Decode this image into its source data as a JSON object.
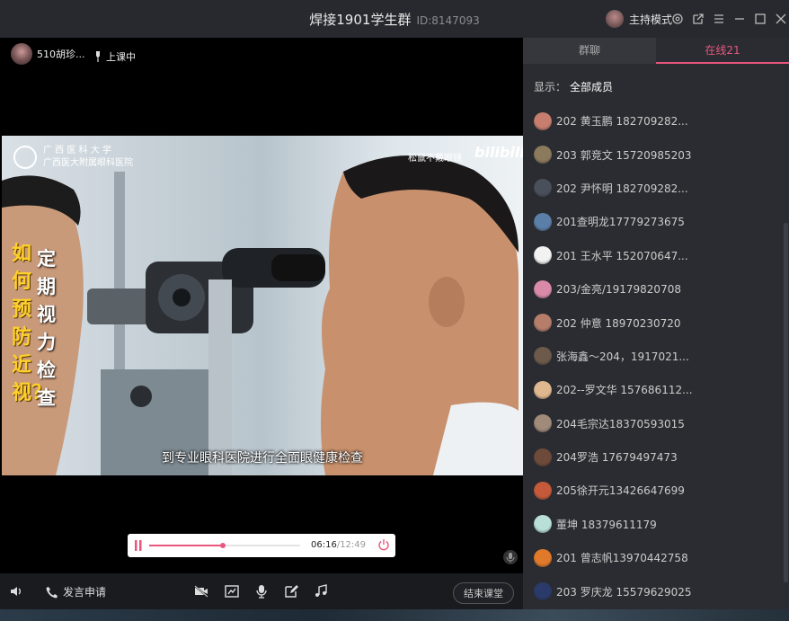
{
  "window": {
    "title": "焊接1901学生群",
    "id_label": "ID:8147093",
    "host_mode_label": "主持模式",
    "icons": [
      "settings-icon",
      "popout-icon",
      "menu-icon",
      "minimize-icon",
      "maximize-icon",
      "close-icon"
    ]
  },
  "presenter": {
    "name": "510胡珍...",
    "status": "上课中"
  },
  "video": {
    "title_yellow": "如何预防近视？",
    "title_white": "定期视力检查",
    "watermark": "松鼠不戴眼镜",
    "brand": "bilibili",
    "school_line1": "广 西 医 科 大 学",
    "school_line2": "广西医大附属眼科医院",
    "subtitle": "到专业眼科医院进行全面眼健康检查"
  },
  "player": {
    "current_time": "06:16",
    "total_time": "/12:49",
    "progress": 0.49,
    "accent_color": "#e9577e"
  },
  "toolbar": {
    "speak_request_label": "发言申请",
    "end_class_label": "结束课堂",
    "icons": [
      "speaker-icon",
      "phone-icon",
      "camera-off-icon",
      "screen-share-icon",
      "microphone-icon",
      "edit-icon",
      "music-icon"
    ]
  },
  "panel": {
    "tabs": [
      {
        "label": "群聊",
        "active": false
      },
      {
        "label": "在线21",
        "active": true
      }
    ],
    "filter_label": "显示：",
    "filter_value": "全部成员",
    "members": [
      {
        "label": "202  黄玉鹏  182709282...",
        "avatar_color": "#c77e6e"
      },
      {
        "label": "203 郭竞文 15720985203",
        "avatar_color": "#8c7a5c"
      },
      {
        "label": "202 尹怀明  182709282...",
        "avatar_color": "#4a4f5c"
      },
      {
        "label": "201查明龙17779273675",
        "avatar_color": "#5b7fa8"
      },
      {
        "label": "201  王水平  152070647...",
        "avatar_color": "#f2f2f2"
      },
      {
        "label": "203/金亮/19179820708",
        "avatar_color": "#d98aa8"
      },
      {
        "label": "202 仲意 18970230720",
        "avatar_color": "#b57d6a"
      },
      {
        "label": "张海鑫～204，1917021...",
        "avatar_color": "#6d5a4a"
      },
      {
        "label": "202--罗文华 157686112...",
        "avatar_color": "#e0b890"
      },
      {
        "label": "204毛宗达18370593015",
        "avatar_color": "#a08a7a"
      },
      {
        "label": "204罗浩  17679497473",
        "avatar_color": "#6e4a3a"
      },
      {
        "label": "205徐开元13426647699",
        "avatar_color": "#c45a3a"
      },
      {
        "label": "董坤      18379611179",
        "avatar_color": "#b8e0d8"
      },
      {
        "label": "201 曾志帆13970442758",
        "avatar_color": "#e07a2a"
      },
      {
        "label": "203 罗庆龙 15579629025",
        "avatar_color": "#2a3a6a"
      }
    ]
  }
}
